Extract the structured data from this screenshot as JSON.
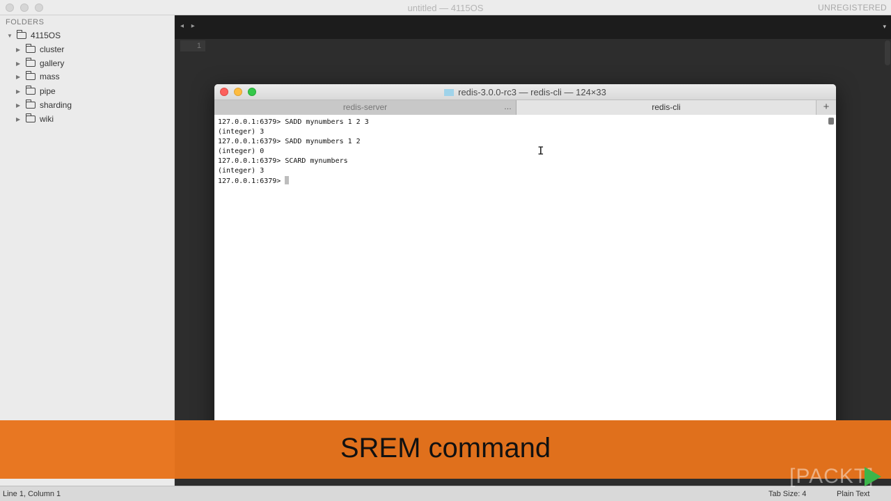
{
  "window": {
    "title": "untitled — 4115OS",
    "registration": "UNREGISTERED"
  },
  "sidebar": {
    "heading": "FOLDERS",
    "root": "4115OS",
    "folders": [
      "cluster",
      "gallery",
      "mass",
      "pipe",
      "sharding",
      "wiki"
    ]
  },
  "editor": {
    "nav": "◂ ▸",
    "menu_glyph": "▾",
    "line_number": "1"
  },
  "terminal": {
    "title": "redis-3.0.0-rc3 — redis-cli — 124×33",
    "tabs": [
      "redis-server",
      "redis-cli"
    ],
    "tab_dots": "…",
    "new_tab": "+",
    "lines": [
      "127.0.0.1:6379> SADD mynumbers 1 2 3",
      "(integer) 3",
      "127.0.0.1:6379> SADD mynumbers 1 2",
      "(integer) 0",
      "127.0.0.1:6379> SCARD mynumbers",
      "(integer) 3",
      "127.0.0.1:6379> "
    ]
  },
  "caption": "SREM command",
  "statusbar": {
    "position": "Line 1, Column 1",
    "tab_size": "Tab Size: 4",
    "syntax": "Plain Text"
  },
  "watermark": {
    "brand": "[PACKT]"
  },
  "colors": {
    "caption_orange": "#e87722",
    "play_green": "#3cb54a"
  }
}
